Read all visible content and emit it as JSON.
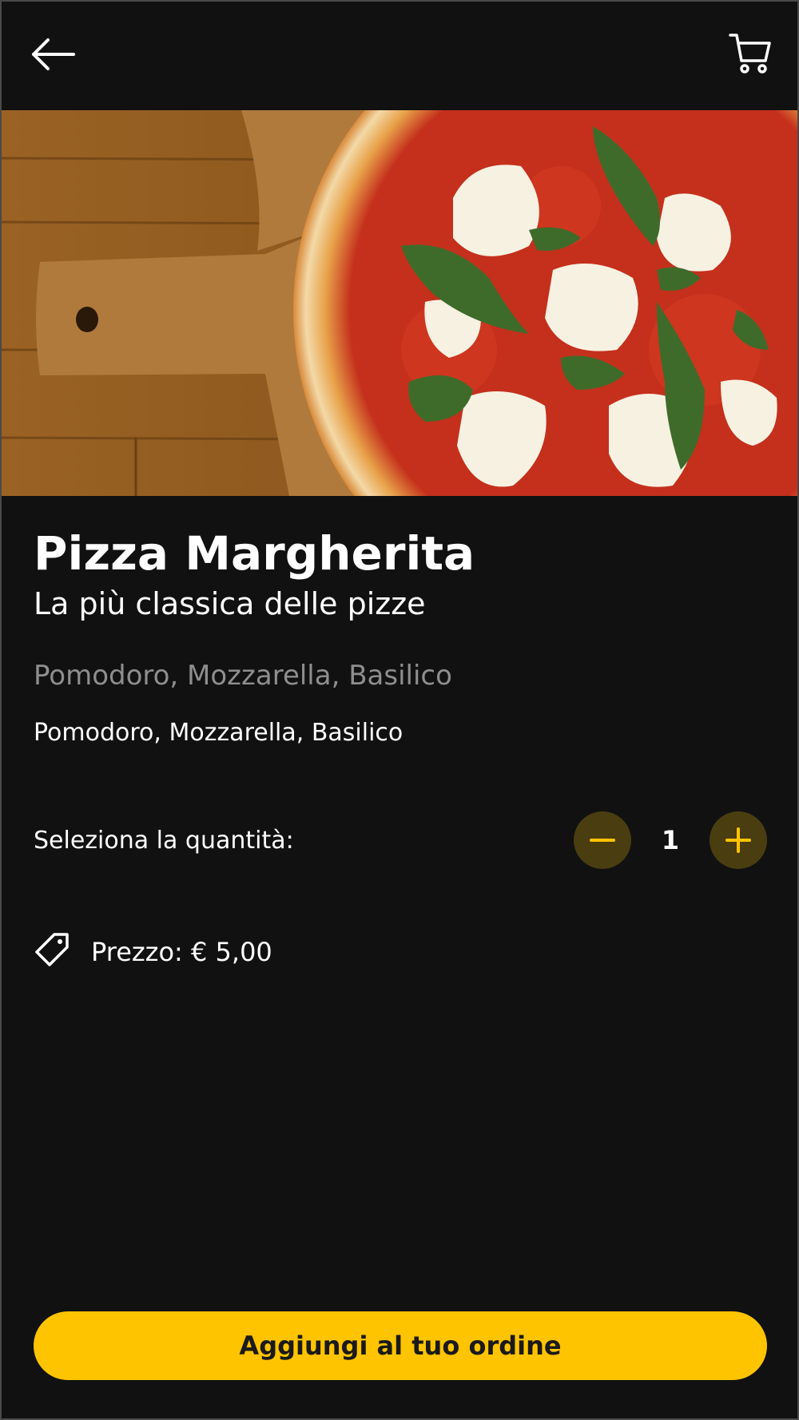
{
  "product": {
    "name": "Pizza Margherita",
    "tagline": "La più classica delle pizze",
    "ingredients_muted": "Pomodoro, Mozzarella, Basilico",
    "ingredients": "Pomodoro, Mozzarella, Basilico"
  },
  "quantity": {
    "label": "Seleziona la quantità:",
    "value": "1"
  },
  "price": {
    "label": "Prezzo:",
    "value": "€ 5,00"
  },
  "actions": {
    "add_to_order": "Aggiungi al tuo ordine"
  },
  "icons": {
    "back": "arrow-left-icon",
    "cart": "shopping-cart-icon",
    "minus": "minus-icon",
    "plus": "plus-icon",
    "price": "tag-icon"
  },
  "colors": {
    "background": "#111111",
    "accent": "#ffc400",
    "stepper_bg": "#4a3d10",
    "muted_text": "#8e8e8e",
    "text": "#ffffff"
  }
}
